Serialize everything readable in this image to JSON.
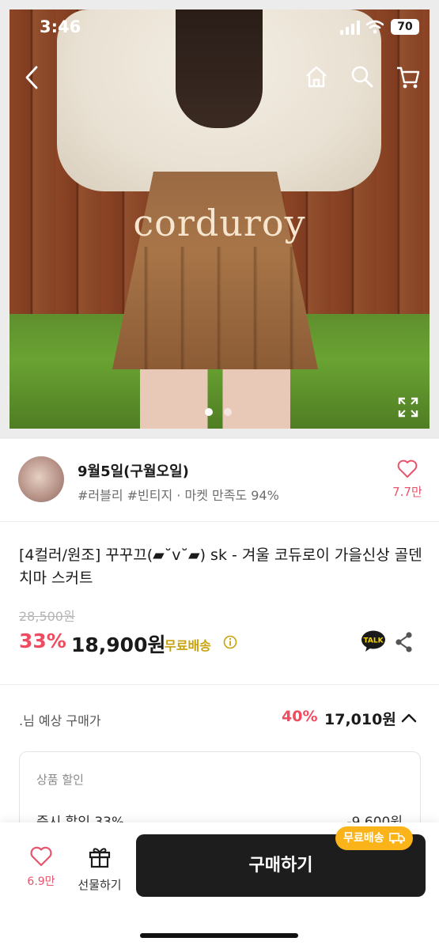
{
  "status_bar": {
    "time": "3:46",
    "battery": "70"
  },
  "hero": {
    "watermark": "corduroy",
    "slide_count": 2,
    "active_slide": 1
  },
  "seller": {
    "name": "9월5일(구월오일)",
    "tags": "#러블리 #빈티지 · 마켓 만족도 94%",
    "likes": "7.7만"
  },
  "product": {
    "title": "[4컬러/원조] 꾸꾸끄(▰˘v˘▰) sk - 겨울 코듀로이 가을신상 골덴 치마 스커트",
    "original_price": "28,500원",
    "discount": "33%",
    "price": "18,900원",
    "free_shipping": "무료배송"
  },
  "expected": {
    "label": ".님 예상 구매가",
    "rate": "40%",
    "price": "17,010원"
  },
  "discount_box": {
    "title": "상품 할인",
    "row_label": "즉시 할인 33%",
    "row_value": "-9,600원"
  },
  "bottom_bar": {
    "likes": "6.9만",
    "gift_label": "선물하기",
    "buy_label": "구매하기",
    "shipping_badge": "무료배송"
  },
  "colors": {
    "accent": "#ef4b61",
    "free_ship": "#c7a20a",
    "badge": "#fbb31a",
    "button": "#1d1d1d"
  }
}
